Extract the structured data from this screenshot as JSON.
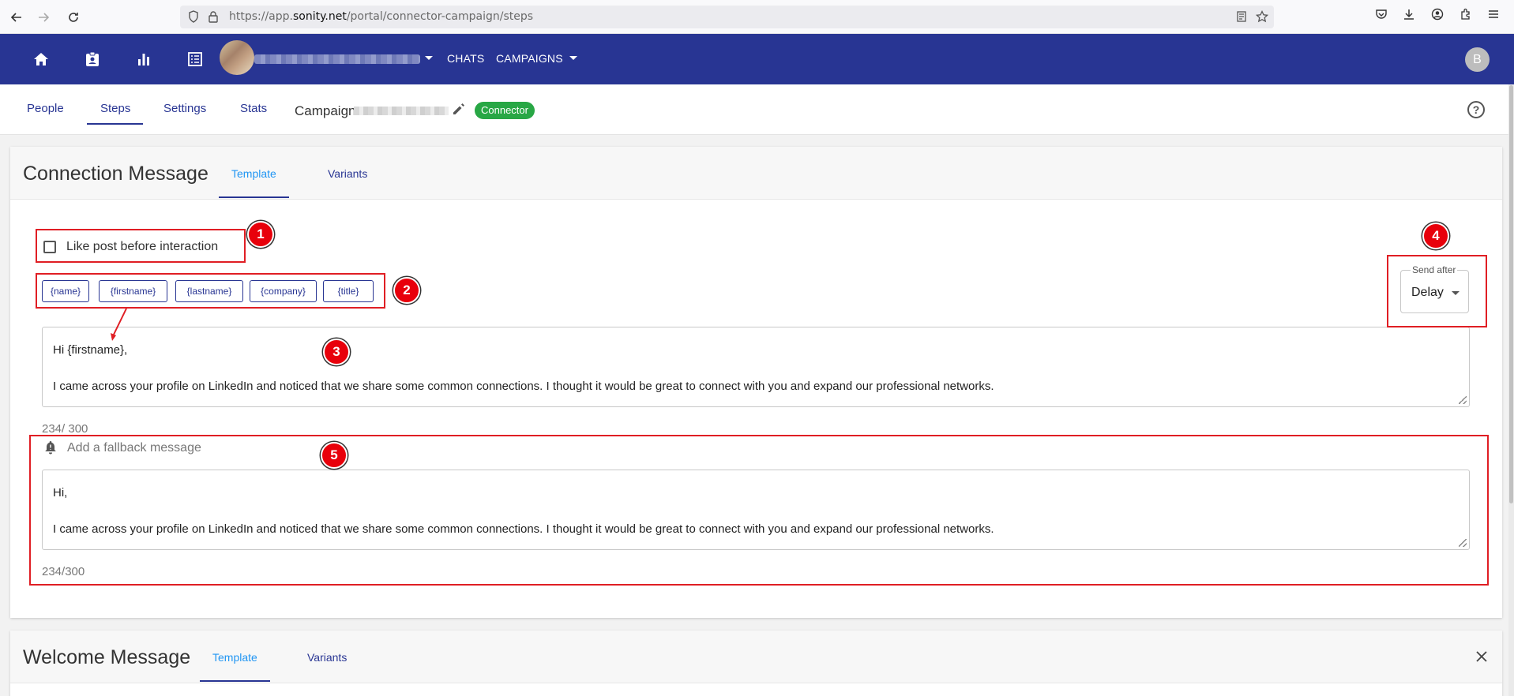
{
  "browser": {
    "url_prefix": "https://app.",
    "url_domain": "sonity.net",
    "url_path": "/portal/connector-campaign/steps"
  },
  "header": {
    "chats_label": "CHATS",
    "campaigns_label": "CAMPAIGNS",
    "user_initial": "B"
  },
  "subnav": {
    "tabs": [
      {
        "label": "People"
      },
      {
        "label": "Steps"
      },
      {
        "label": "Settings"
      },
      {
        "label": "Stats"
      }
    ],
    "campaign_label": "Campaign",
    "type_badge": "Connector",
    "colors": {
      "badge": "#28a745",
      "header_bg": "#283593"
    }
  },
  "connection_card": {
    "title": "Connection Message",
    "tabs": [
      {
        "label": "Template"
      },
      {
        "label": "Variants"
      }
    ],
    "like_post_label": "Like post before interaction",
    "like_post_checked": false,
    "variables": [
      "{name}",
      "{firstname}",
      "{lastname}",
      "{company}",
      "{title}"
    ],
    "message_line1": "Hi {firstname},",
    "message_line2": "I came across your profile on LinkedIn and noticed that we share some common connections. I thought it would be great to connect with you and expand our professional networks.",
    "counter": "234/ 300",
    "send_after_label": "Send after",
    "send_after_value": "Delay",
    "fallback_label": "Add a fallback message",
    "fallback_line1": "Hi,",
    "fallback_line2": "I came across your profile on LinkedIn and noticed that we share some common connections. I thought it would be great to connect with you and expand our professional networks.",
    "fallback_counter": "234/300"
  },
  "welcome_card": {
    "title": "Welcome Message",
    "tabs": [
      {
        "label": "Template"
      },
      {
        "label": "Variants"
      }
    ]
  },
  "annotations": [
    "1",
    "2",
    "3",
    "4",
    "5"
  ],
  "annotation_color": "#e01e24"
}
